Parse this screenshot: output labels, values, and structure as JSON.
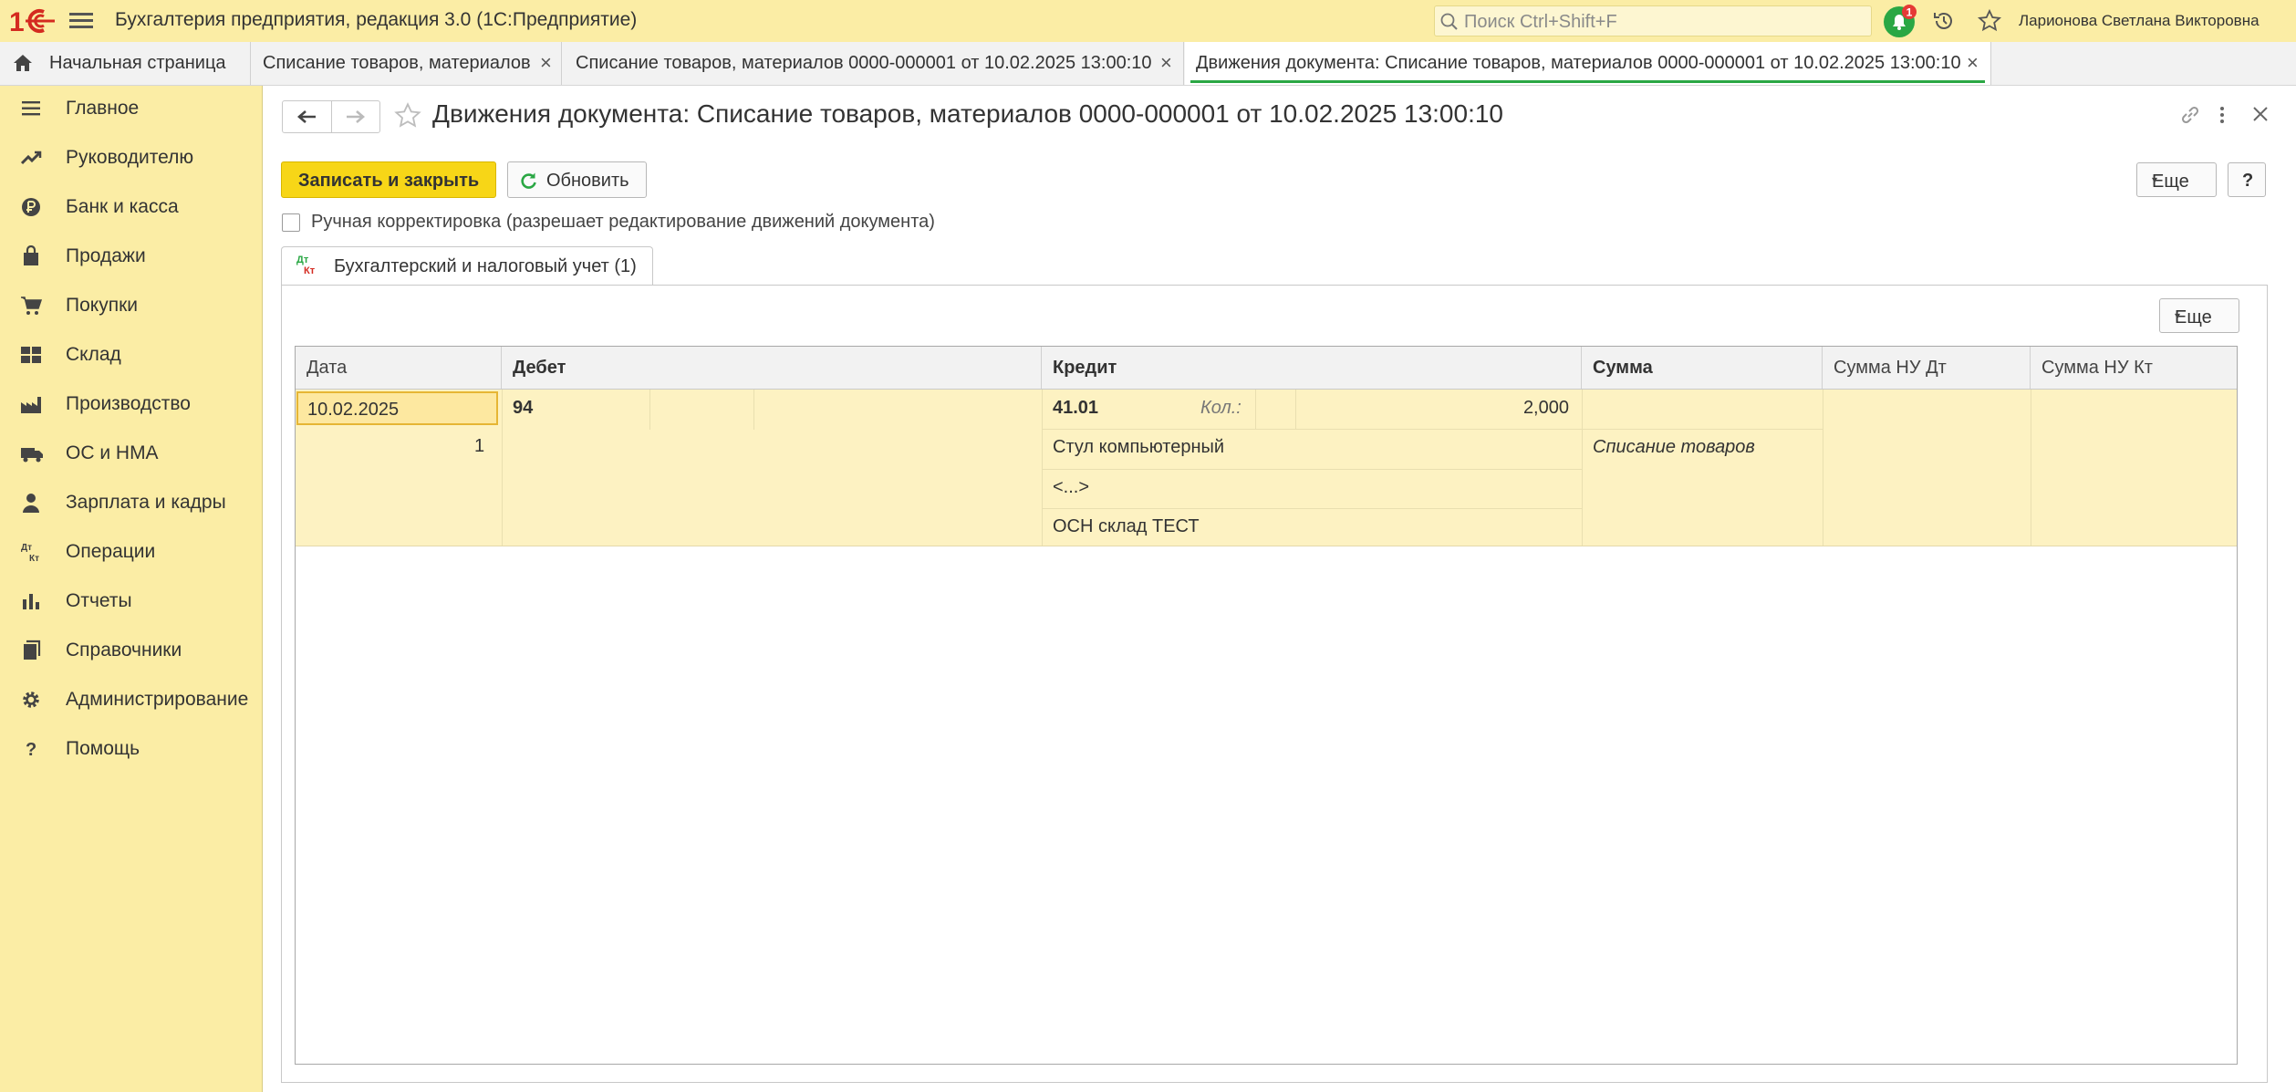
{
  "app": {
    "title": "Бухгалтерия предприятия, редакция 3.0  (1С:Предприятие)",
    "search_placeholder": "Поиск Ctrl+Shift+F",
    "notifications_count": "1",
    "user_name": "Ларионова Светлана Викторовна",
    "accent_color": "#fbeda5",
    "brand_color": "#d42a20"
  },
  "tabs": [
    {
      "label": "Начальная страница"
    },
    {
      "label": "Списание товаров, материалов"
    },
    {
      "label": "Списание товаров, материалов 0000-000001 от 10.02.2025 13:00:10"
    },
    {
      "label": "Движения документа: Списание товаров, материалов 0000-000001 от 10.02.2025 13:00:10"
    }
  ],
  "sidebar": {
    "items": [
      {
        "label": "Главное",
        "icon": "menu-icon"
      },
      {
        "label": "Руководителю",
        "icon": "trend-icon"
      },
      {
        "label": "Банк и касса",
        "icon": "ruble-icon"
      },
      {
        "label": "Продажи",
        "icon": "bag-icon"
      },
      {
        "label": "Покупки",
        "icon": "cart-icon"
      },
      {
        "label": "Склад",
        "icon": "warehouse-icon"
      },
      {
        "label": "Производство",
        "icon": "factory-icon"
      },
      {
        "label": "ОС и НМА",
        "icon": "truck-icon"
      },
      {
        "label": "Зарплата и кадры",
        "icon": "person-icon"
      },
      {
        "label": "Операции",
        "icon": "dt-kt-icon"
      },
      {
        "label": "Отчеты",
        "icon": "bar-chart-icon"
      },
      {
        "label": "Справочники",
        "icon": "books-icon"
      },
      {
        "label": "Администрирование",
        "icon": "gear-icon"
      },
      {
        "label": "Помощь",
        "icon": "question-icon"
      }
    ]
  },
  "form": {
    "title": "Движения документа: Списание товаров, материалов 0000-000001 от 10.02.2025 13:00:10",
    "save_close_label": "Записать и закрыть",
    "refresh_label": "Обновить",
    "more_label": "Еще",
    "help_label": "?",
    "manual_edit_label": "Ручная корректировка (разрешает редактирование движений документа)",
    "manual_edit_checked": false,
    "panel_tab_label": "Бухгалтерский и налоговый учет (1)",
    "panel_tab_icon_top": "Дт",
    "panel_tab_icon_bottom": "Кт",
    "panel_more_label": "Еще"
  },
  "grid": {
    "columns": [
      "Дата",
      "Дебет",
      "Кредит",
      "Сумма",
      "Сумма НУ Дт",
      "Сумма НУ Кт"
    ],
    "rows": [
      {
        "date": "10.02.2025",
        "line_no": "1",
        "debit_account": "94",
        "credit_account": "41.01",
        "qty_label": "Кол.:",
        "qty": "2,000",
        "credit_subconto1": "Стул компьютерный",
        "credit_subconto2": "<...>",
        "credit_subconto3": "ОСН склад ТЕСТ",
        "sum": "",
        "content": "Списание товаров",
        "sum_nu_dt": "",
        "sum_nu_kt": ""
      }
    ]
  }
}
